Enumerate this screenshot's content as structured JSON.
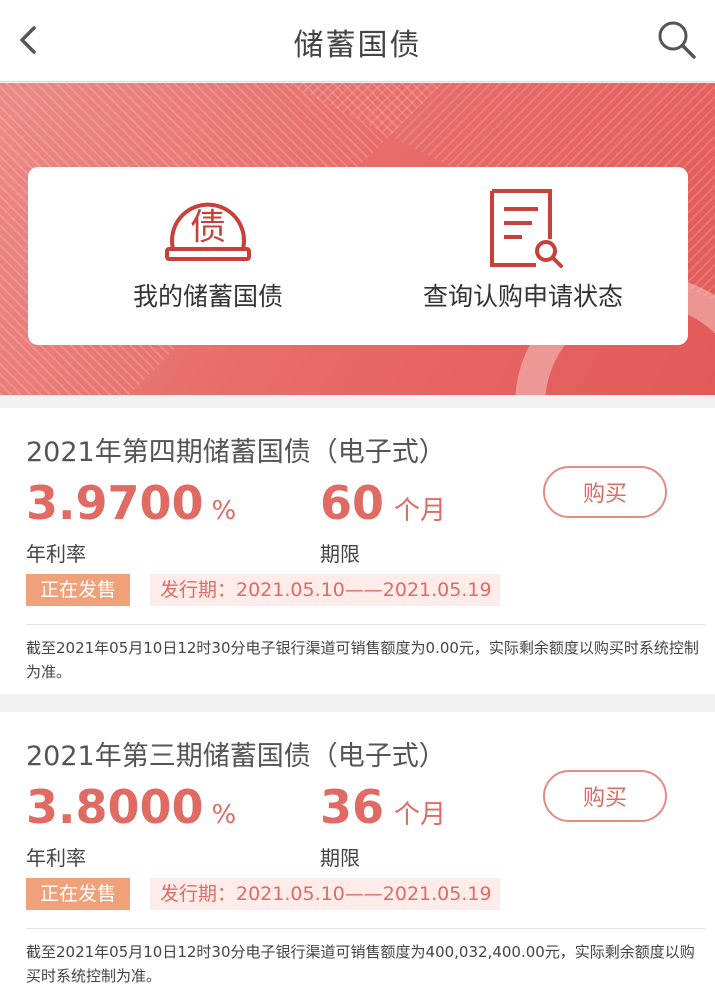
{
  "nav": {
    "title": "储蓄国债"
  },
  "quick_actions": {
    "my_bonds_label": "我的储蓄国债",
    "bond_icon_char": "债",
    "query_status_label": "查询认购申请状态"
  },
  "bonds": [
    {
      "title": "2021年第四期储蓄国债（电子式）",
      "rate": "3.9700",
      "rate_unit": "%",
      "rate_label": "年利率",
      "term": "60",
      "term_unit": "个月",
      "term_label": "期限",
      "buy_label": "购买",
      "status": "正在发售",
      "period": "发行期：2021.05.10——2021.05.19",
      "note": "截至2021年05月10日12时30分电子银行渠道可销售额度为0.00元，实际剩余额度以购买时系统控制为准。"
    },
    {
      "title": "2021年第三期储蓄国债（电子式）",
      "rate": "3.8000",
      "rate_unit": "%",
      "rate_label": "年利率",
      "term": "36",
      "term_unit": "个月",
      "term_label": "期限",
      "buy_label": "购买",
      "status": "正在发售",
      "period": "发行期：2021.05.10——2021.05.19",
      "note": "截至2021年05月10日12时30分电子银行渠道可销售额度为400,032,400.00元，实际剩余额度以购买时系统控制为准。"
    }
  ],
  "colors": {
    "accent": "#e06b64",
    "badge": "#f0a17a",
    "banner": "#e86d6a"
  }
}
